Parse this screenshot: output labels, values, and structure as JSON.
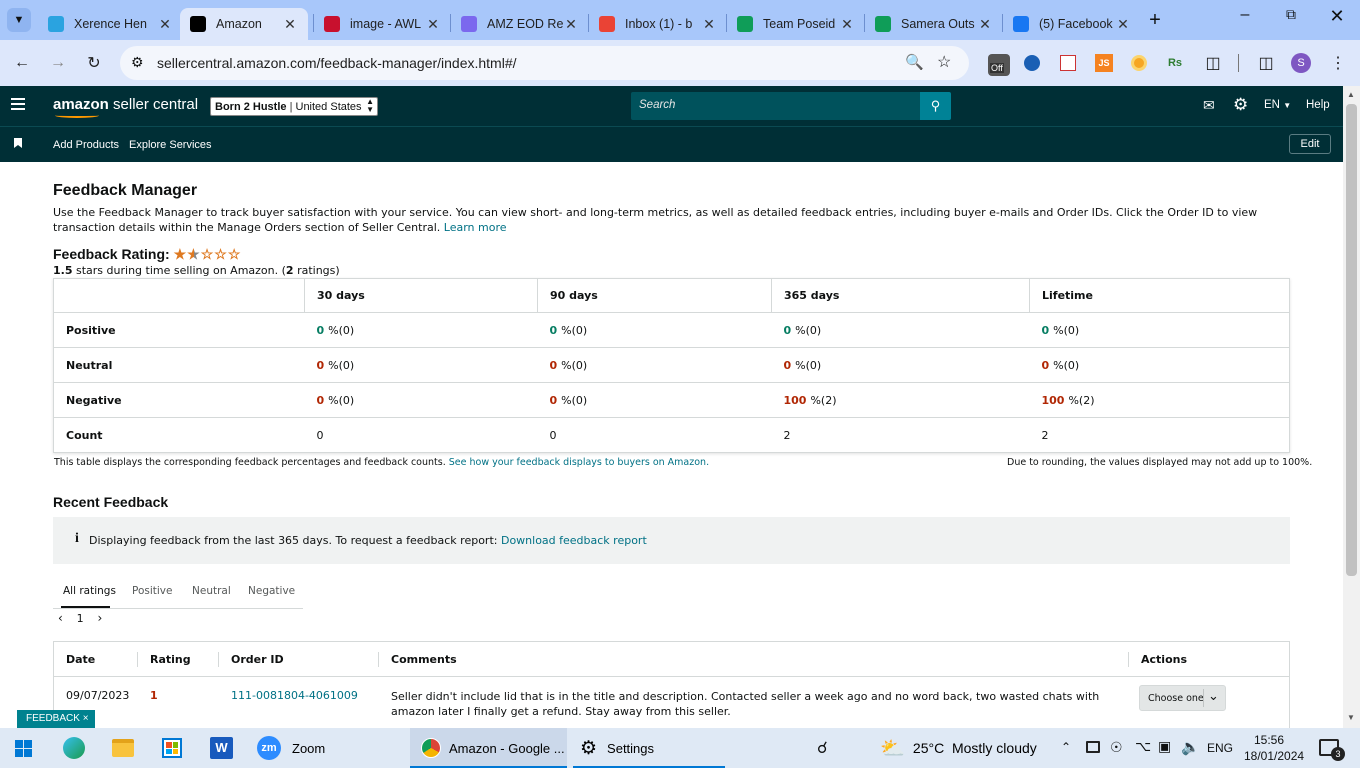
{
  "browser": {
    "tabs": [
      {
        "title": "Xerence Hen",
        "icon": "telegram-icon",
        "color": "#2aa3e0"
      },
      {
        "title": "Amazon",
        "icon": "amazon-icon",
        "color": "#000000"
      },
      {
        "title": "image - AWL",
        "icon": "awl-icon",
        "color": "#c8102e"
      },
      {
        "title": "AMZ EOD Re",
        "icon": "clickup-icon",
        "color": "#7b68ee"
      },
      {
        "title": "Inbox (1) - b",
        "icon": "gmail-icon",
        "color": "#ea4335"
      },
      {
        "title": "Team Poseid",
        "icon": "sheets-icon",
        "color": "#0f9d58"
      },
      {
        "title": "Samera Outs",
        "icon": "sheets-icon",
        "color": "#0f9d58"
      },
      {
        "title": "(5) Facebook",
        "icon": "facebook-icon",
        "color": "#1877f2"
      }
    ],
    "url": "sellercentral.amazon.com/feedback-manager/index.html#/",
    "ext_off_badge": "Off",
    "ext_js": "JS",
    "ext_rs": "Rs",
    "profile_initial": "S"
  },
  "header": {
    "logo_bold": "amazon",
    "logo_rest": " seller central",
    "store_name": "Born 2 Hustle",
    "store_country": "United States",
    "search_placeholder": "Search",
    "language": "EN",
    "help": "Help"
  },
  "nav": {
    "items": [
      "Add Products",
      "Explore Services"
    ],
    "edit": "Edit"
  },
  "page": {
    "title": "Feedback Manager",
    "description": "Use the Feedback Manager to track buyer satisfaction with your service. You can view short- and long-term metrics, as well as detailed feedback entries, including buyer e-mails and Order IDs. Click the Order ID to view transaction details within the Manage Orders section of Seller Central.",
    "learn_more": "Learn more",
    "rating_label": "Feedback Rating:",
    "rating_value": 1.5,
    "rating_summary_stars": "1.5",
    "rating_summary_text": " stars during time selling on Amazon. (",
    "rating_count": "2",
    "rating_summary_end": " ratings)"
  },
  "metrics": {
    "columns": [
      "30 days",
      "90 days",
      "365 days",
      "Lifetime"
    ],
    "rows": [
      {
        "label": "Positive",
        "cells": [
          {
            "v": "0",
            "s": "%(0)"
          },
          {
            "v": "0",
            "s": "%(0)"
          },
          {
            "v": "0",
            "s": "%(0)"
          },
          {
            "v": "0",
            "s": "%(0)"
          }
        ]
      },
      {
        "label": "Neutral",
        "cells": [
          {
            "v": "0",
            "s": "%(0)"
          },
          {
            "v": "0",
            "s": "%(0)"
          },
          {
            "v": "0",
            "s": "%(0)"
          },
          {
            "v": "0",
            "s": "%(0)"
          }
        ]
      },
      {
        "label": "Negative",
        "cells": [
          {
            "v": "0",
            "s": "%(0)"
          },
          {
            "v": "0",
            "s": "%(0)"
          },
          {
            "v": "100",
            "s": "%(2)"
          },
          {
            "v": "100",
            "s": "%(2)"
          }
        ]
      },
      {
        "label": "Count",
        "cells": [
          {
            "v": "0",
            "s": ""
          },
          {
            "v": "0",
            "s": ""
          },
          {
            "v": "2",
            "s": ""
          },
          {
            "v": "2",
            "s": ""
          }
        ]
      }
    ],
    "footnote": "This table displays the corresponding feedback percentages and feedback counts.",
    "footnote_link": "See how your feedback displays to buyers on Amazon.",
    "rounding_note": "Due to rounding, the values displayed may not add up to 100%."
  },
  "recent": {
    "title": "Recent Feedback",
    "info_text": "Displaying feedback from the last 365 days. To request a feedback report:",
    "info_link": "Download feedback report",
    "tabs": [
      "All ratings",
      "Positive",
      "Neutral",
      "Negative"
    ],
    "page": "1",
    "columns": [
      "Date",
      "Rating",
      "Order ID",
      "Comments",
      "Actions"
    ],
    "rows": [
      {
        "date": "09/07/2023",
        "rating": "1",
        "order_id": "111-0081804-4061009",
        "comment": "Seller didn't include lid that is in the title and description. Contacted seller a week ago and no word back, two wasted chats with amazon later I finally get a refund. Stay away from this seller.",
        "action": "Choose one"
      }
    ],
    "feedback_badge": "FEEDBACK"
  },
  "taskbar": {
    "apps": [
      "Zoom",
      "Amazon - Google ...",
      "Settings"
    ],
    "weather": "25°C  Mostly cloudy",
    "lang": "ENG",
    "time": "15:56",
    "date": "18/01/2024",
    "notifications": "3"
  },
  "colors": {
    "amazon_dark": "#002f36",
    "search_btn": "#008296",
    "link": "#007185",
    "positive": "#067d62",
    "negative": "#b12704"
  }
}
